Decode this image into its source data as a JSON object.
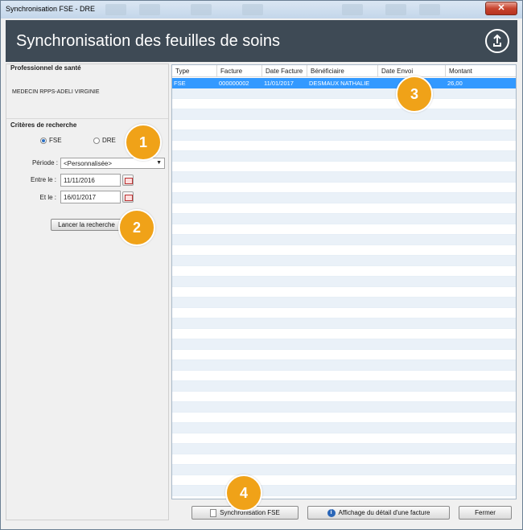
{
  "window": {
    "title": "Synchronisation FSE - DRE",
    "close_glyph": "✕"
  },
  "header": {
    "title": "Synchronisation des feuilles de soins",
    "icon": "sync-icon"
  },
  "professional": {
    "section_title": "Professionnel de santé",
    "name": "MEDECIN RPPS-ADELI VIRGINIE"
  },
  "criteria": {
    "section_title": "Critères de recherche",
    "radio_fse": "FSE",
    "radio_dre": "DRE",
    "selected": "FSE",
    "period_label": "Période :",
    "period_value": "<Personnalisée>",
    "from_label": "Entre le :",
    "from_value": "11/11/2016",
    "to_label": "Et le :",
    "to_value": "16/01/2017",
    "search_button": "Lancer la recherche"
  },
  "table": {
    "columns": [
      "Type",
      "Facture",
      "Date Facture",
      "Bénéficiaire",
      "Date Envoi",
      "Montant"
    ],
    "rows": [
      {
        "type": "FSE",
        "facture": "000000002",
        "date_facture": "11/01/2017",
        "beneficiaire": "DESMAUX NATHALIE",
        "date_envoi": "",
        "montant": "26,00"
      }
    ]
  },
  "footer": {
    "sync_button": "Synchronisation FSE",
    "detail_button": "Affichage du détail d'une facture",
    "close_button": "Fermer"
  },
  "badges": [
    "1",
    "2",
    "3",
    "4"
  ],
  "colors": {
    "header_bg": "#3e4a55",
    "selection": "#3399ff",
    "badge": "#f0a218"
  }
}
